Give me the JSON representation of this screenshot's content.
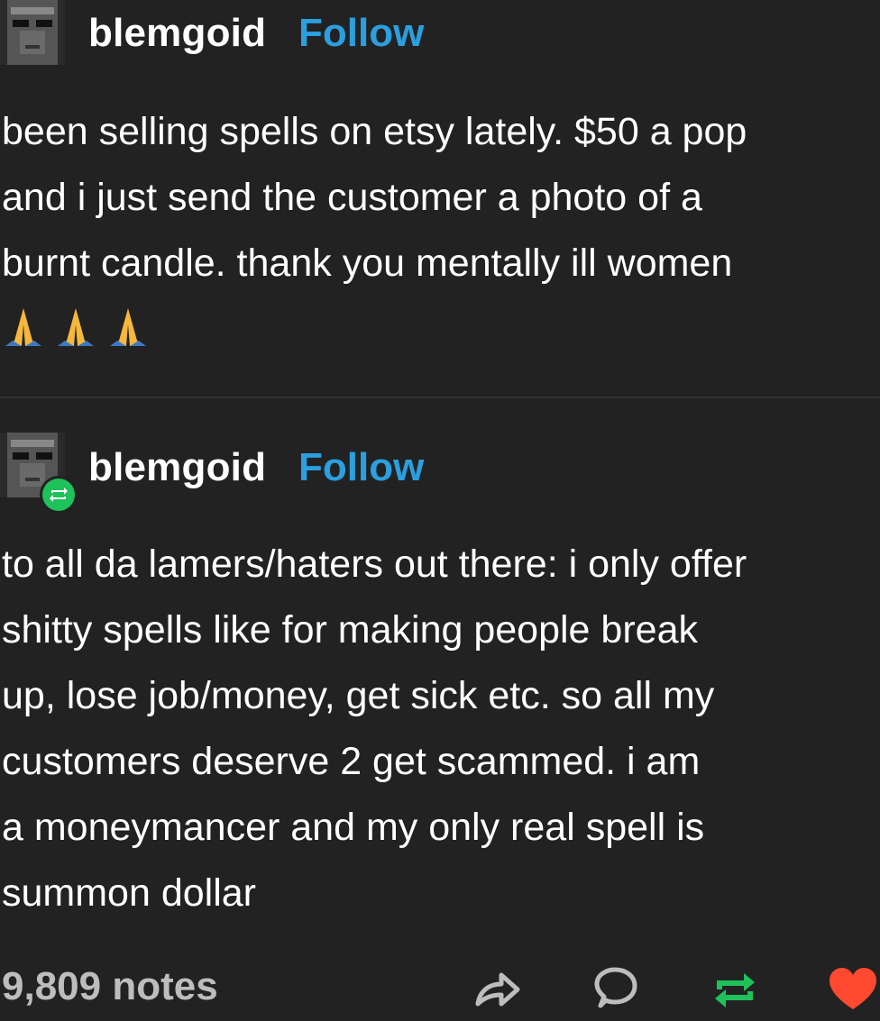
{
  "posts": [
    {
      "username": "blemgoid",
      "follow_label": "Follow",
      "body_lines": [
        "been selling spells on etsy lately. $50 a pop",
        "and i just send the customer a photo of a",
        "burnt candle. thank you mentally ill women"
      ],
      "emojis": [
        "🙏",
        "🙏",
        "🙏"
      ]
    },
    {
      "username": "blemgoid",
      "follow_label": "Follow",
      "reblogged": true,
      "body_lines": [
        "to all da lamers/haters out there: i only offer",
        "shitty spells like for making people break",
        "up, lose job/money, get sick etc. so all my",
        "customers deserve 2 get scammed. i am",
        "a moneymancer and my only real spell is",
        "summon dollar"
      ]
    }
  ],
  "footer": {
    "notes_label": "9,809 notes",
    "actions": [
      "share-icon",
      "reply-icon",
      "reblog-icon",
      "like-icon"
    ]
  },
  "colors": {
    "background": "#222222",
    "follow": "#2b9fdf",
    "reblog": "#1ec15a",
    "like": "#ff4930"
  }
}
